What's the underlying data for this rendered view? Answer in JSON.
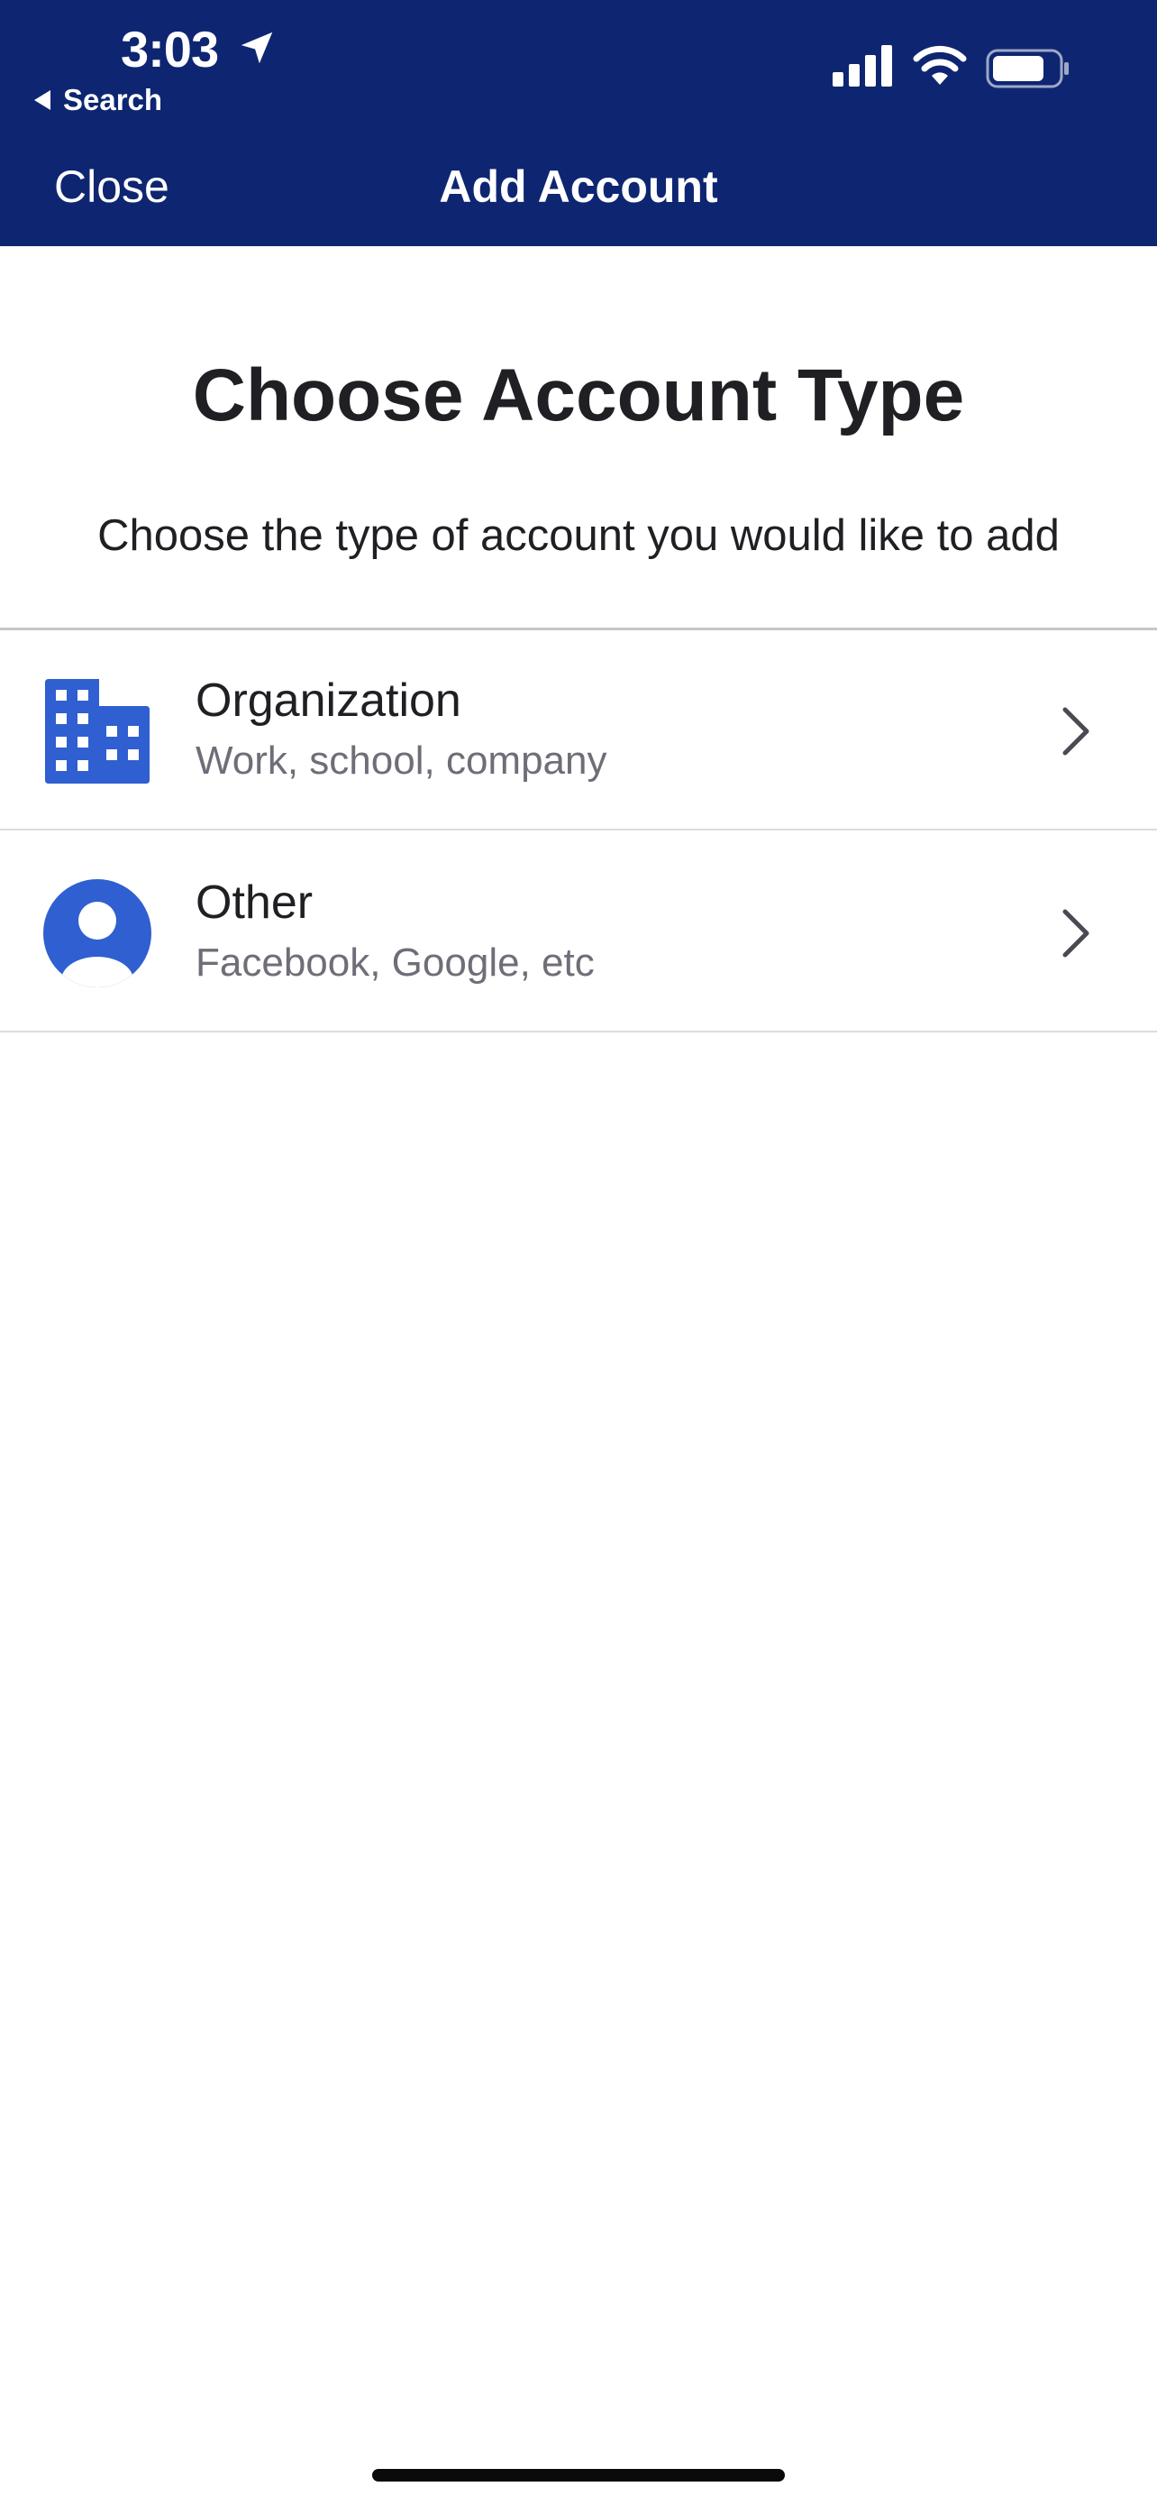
{
  "status_bar": {
    "time": "3:03",
    "back_label": "Search"
  },
  "nav": {
    "close_label": "Close",
    "title": "Add Account"
  },
  "content": {
    "title": "Choose Account Type",
    "subtitle": "Choose the type of account you would like to add"
  },
  "options": [
    {
      "title": "Organization",
      "subtitle": "Work, school, company",
      "icon": "building-icon"
    },
    {
      "title": "Other",
      "subtitle": "Facebook, Google, etc",
      "icon": "person-icon"
    }
  ],
  "colors": {
    "header_bg": "#0e2672",
    "accent": "#2f5fd0",
    "text_primary": "#1f1f24",
    "text_secondary": "#6e6e78"
  }
}
